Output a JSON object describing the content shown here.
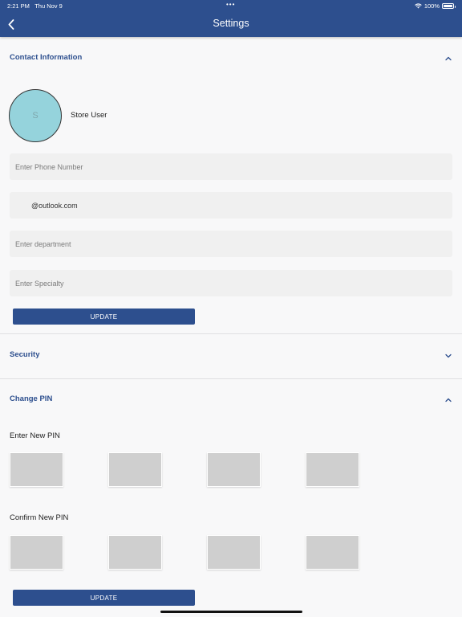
{
  "status_bar": {
    "time": "2:21 PM",
    "date": "Thu Nov 9",
    "dots": "•••",
    "battery": "100%"
  },
  "header": {
    "title": "Settings"
  },
  "contact": {
    "title": "Contact Information",
    "avatar_initial": "S",
    "user_name": "Store User",
    "phone_placeholder": "Enter Phone Number",
    "email_value": "        @outlook.com",
    "department_placeholder": "Enter department",
    "specialty_placeholder": "Enter Specialty",
    "update_label": "UPDATE"
  },
  "security": {
    "title": "Security"
  },
  "change_pin": {
    "title": "Change PIN",
    "new_pin_label": "Enter New PIN",
    "confirm_pin_label": "Confirm New PIN",
    "update_label": "UPDATE"
  },
  "colors": {
    "brand": "#2d4f8e",
    "avatar_bg": "#95d3dc",
    "field_bg": "#f0f0f0",
    "pin_box": "#cfcfcf"
  },
  "icons": {
    "back": "chevron-left-icon",
    "collapse": "chevron-up-icon",
    "expand": "chevron-down-icon",
    "wifi": "wifi-icon",
    "battery": "battery-icon"
  }
}
